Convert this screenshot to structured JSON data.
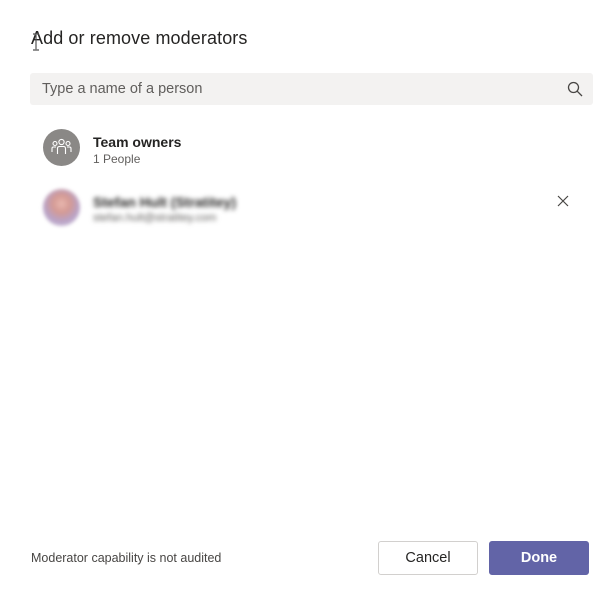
{
  "dialog": {
    "title": "Add or remove moderators"
  },
  "search": {
    "placeholder": "Type a name of a person",
    "value": "",
    "icon": "search-icon"
  },
  "moderators": [
    {
      "name": "Team owners",
      "subtitle": "1 People",
      "icon": "team-icon"
    },
    {
      "name": "Stefan Hult (Stratitey)",
      "subtitle": "stefan.hult@stratitey.com",
      "removable": true
    }
  ],
  "footer": {
    "note": "Moderator capability is not audited",
    "cancel_label": "Cancel",
    "done_label": "Done"
  },
  "colors": {
    "primary": "#6264a7",
    "search_bg": "#f3f2f1",
    "avatar_gray": "#8a8886"
  }
}
